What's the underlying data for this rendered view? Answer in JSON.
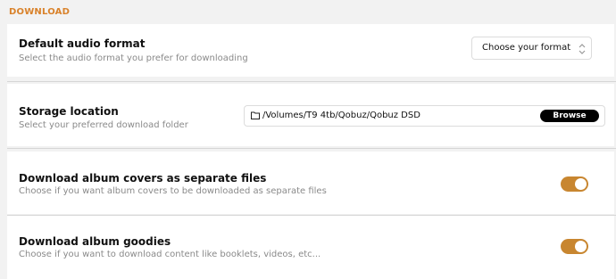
{
  "section": {
    "title": "DOWNLOAD"
  },
  "settings": {
    "audio_format": {
      "title": "Default audio format",
      "subtitle": "Select the audio format you prefer for downloading",
      "select_value": "Choose your format",
      "icon": "chevron-updown-icon"
    },
    "storage": {
      "title": "Storage location",
      "subtitle": "Select your preferred download folder",
      "path": "/Volumes/T9 4tb/Qobuz/Qobuz DSD",
      "browse_label": "Browse",
      "icon": "folder-icon"
    },
    "album_covers": {
      "title": "Download album covers as separate files",
      "subtitle": "Choose if you want album covers to be downloaded as separate files",
      "enabled": true
    },
    "album_goodies": {
      "title": "Download album goodies",
      "subtitle": "Choose if you want to download content like booklets, videos, etc...",
      "enabled": true
    }
  },
  "colors": {
    "accent": "#d9822b",
    "toggle_on": "#c88630",
    "button_bg": "#000000"
  }
}
